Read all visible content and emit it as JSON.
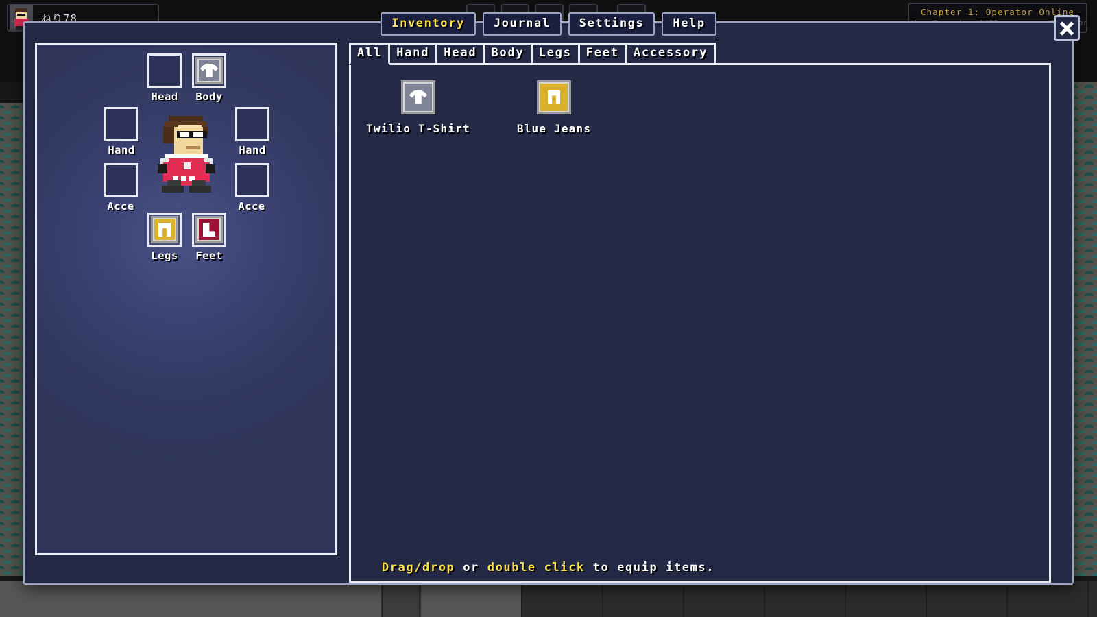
{
  "hud": {
    "player_name": "ねり78",
    "avatar_name": "player-avatar",
    "buttons": [
      {
        "name": "map-icon",
        "glyph": "🗺"
      },
      {
        "name": "bag-icon",
        "glyph": "▭"
      },
      {
        "name": "star-icon",
        "glyph": "✦"
      },
      {
        "name": "help-icon",
        "glyph": "?"
      },
      {
        "name": "heart-icon",
        "glyph": "♥"
      }
    ],
    "chapter_title": "Chapter 1: Operator Online",
    "chapter_subtitle": "Level up dev skills as a new Operator in"
  },
  "top_tabs": [
    {
      "label": "Inventory",
      "active": true
    },
    {
      "label": "Journal",
      "active": false
    },
    {
      "label": "Settings",
      "active": false
    },
    {
      "label": "Help",
      "active": false
    }
  ],
  "close_button": {
    "label": "×",
    "name": "close-icon"
  },
  "equipment": {
    "panel_name": "equipment-panel",
    "slots": [
      {
        "id": "head",
        "label": "Head",
        "filled": false,
        "icon": null,
        "color": null
      },
      {
        "id": "body",
        "label": "Body",
        "filled": true,
        "icon": "shirt",
        "color": "#7f8497"
      },
      {
        "id": "hand-left",
        "label": "Hand",
        "filled": false,
        "icon": null,
        "color": null
      },
      {
        "id": "hand-right",
        "label": "Hand",
        "filled": false,
        "icon": null,
        "color": null
      },
      {
        "id": "accessory-left",
        "label": "Acce",
        "filled": false,
        "icon": null,
        "color": null
      },
      {
        "id": "accessory-right",
        "label": "Acce",
        "filled": false,
        "icon": null,
        "color": null
      },
      {
        "id": "legs",
        "label": "Legs",
        "filled": true,
        "icon": "pants",
        "color": "#d9b128"
      },
      {
        "id": "feet",
        "label": "Feet",
        "filled": true,
        "icon": "boot",
        "color": "#9b1436"
      }
    ],
    "character": {
      "name": "player-character-sprite",
      "hair_color": "#4a2c18",
      "skin_color": "#f2d79c",
      "shirt_color": "#e02e52",
      "accent_color": "#ffffff",
      "boot_color": "#2e2e2e"
    }
  },
  "filter_tabs": [
    {
      "label": "All",
      "active": true
    },
    {
      "label": "Hand",
      "active": false
    },
    {
      "label": "Head",
      "active": false
    },
    {
      "label": "Body",
      "active": false
    },
    {
      "label": "Legs",
      "active": false
    },
    {
      "label": "Feet",
      "active": false
    },
    {
      "label": "Accessory",
      "active": false
    }
  ],
  "inventory_items": [
    {
      "name": "Twilio T-Shirt",
      "icon": "shirt",
      "color": "#7f8497",
      "slot_class": ""
    },
    {
      "name": "Blue Jeans",
      "icon": "pants",
      "color": "#d9b128",
      "slot_class": "gold"
    }
  ],
  "hint": {
    "part1": "Drag/drop",
    "part2": "or",
    "part3": "double click",
    "part4": "to equip items."
  },
  "colors": {
    "modal_bg": "#232845",
    "border": "#e8eaf4",
    "accent_yellow": "#ffe34d",
    "chapter_gold": "#c8a43c",
    "panel_glow": "#4a5287"
  }
}
